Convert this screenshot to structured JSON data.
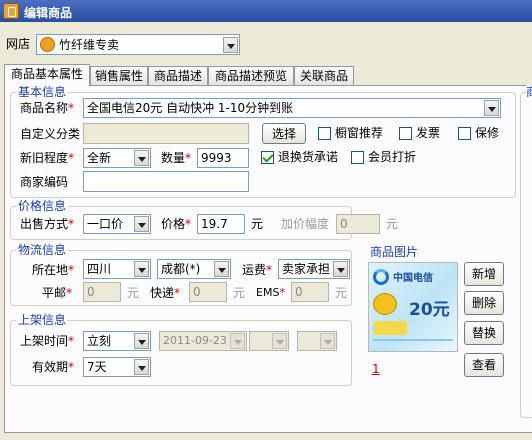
{
  "window": {
    "title": "编辑商品"
  },
  "shop": {
    "label": "网店",
    "value": "竹纤维专卖"
  },
  "tabs": [
    {
      "label": "商品基本属性"
    },
    {
      "label": "销售属性"
    },
    {
      "label": "商品描述"
    },
    {
      "label": "商品描述预览"
    },
    {
      "label": "关联商品"
    }
  ],
  "basic": {
    "group_title": "基本信息",
    "name_label": "商品名称",
    "name_value": "全国电信20元 自动快冲 1-10分钟到账",
    "custom_category_label": "自定义分类",
    "select_button": "选择",
    "window_recommend": "橱窗推荐",
    "invoice": "发票",
    "warranty": "保修",
    "condition_label": "新旧程度",
    "condition_value": "全新",
    "quantity_label": "数量",
    "quantity_value": "9993",
    "return_promise": "退换货承诺",
    "member_discount": "会员打折",
    "merchant_code_label": "商家编码",
    "merchant_code_value": ""
  },
  "price": {
    "group_title": "价格信息",
    "sale_method_label": "出售方式",
    "sale_method_value": "一口价",
    "price_label": "价格",
    "price_value": "19.7",
    "price_unit": "元",
    "increment_label": "加价幅度",
    "increment_value": "0",
    "increment_unit": "元"
  },
  "logistics": {
    "group_title": "物流信息",
    "location_label": "所在地",
    "province": "四川",
    "city": "成都(*)",
    "shipping_label": "运费",
    "shipping_value": "卖家承担",
    "post_label": "平邮",
    "post_value": "0",
    "post_unit": "元",
    "express_label": "快递",
    "express_value": "0",
    "express_unit": "元",
    "ems_label": "EMS",
    "ems_value": "0",
    "ems_unit": "元"
  },
  "image": {
    "title": "商品图片",
    "card_logo": "中国电信",
    "card_amount": "20元",
    "add_button": "新增",
    "delete_button": "删除",
    "replace_button": "替换",
    "view_button": "查看",
    "index": "1"
  },
  "listing": {
    "group_title": "上架信息",
    "time_label": "上架时间",
    "time_value": "立刻",
    "date_value": "2011-09-23",
    "validity_label": "有效期",
    "validity_value": "7天"
  },
  "colors": {
    "title_bar": "#2a4f9e",
    "group_title": "#1d3ca8",
    "required": "#d40000"
  }
}
